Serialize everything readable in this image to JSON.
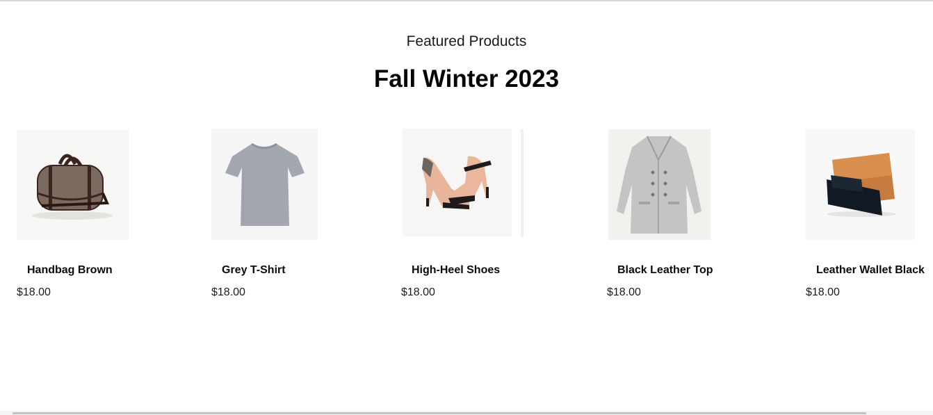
{
  "section": {
    "eyebrow": "Featured Products",
    "headline": "Fall Winter 2023"
  },
  "products": [
    {
      "name": "Handbag Brown",
      "price": "$18.00",
      "icon": "handbag-icon"
    },
    {
      "name": "Grey T-Shirt",
      "price": "$18.00",
      "icon": "tshirt-icon"
    },
    {
      "name": "High-Heel Shoes",
      "price": "$18.00",
      "icon": "shoes-icon"
    },
    {
      "name": "Black Leather Top",
      "price": "$18.00",
      "icon": "coat-icon"
    },
    {
      "name": "Leather Wallet Black",
      "price": "$18.00",
      "icon": "wallet-icon"
    }
  ]
}
